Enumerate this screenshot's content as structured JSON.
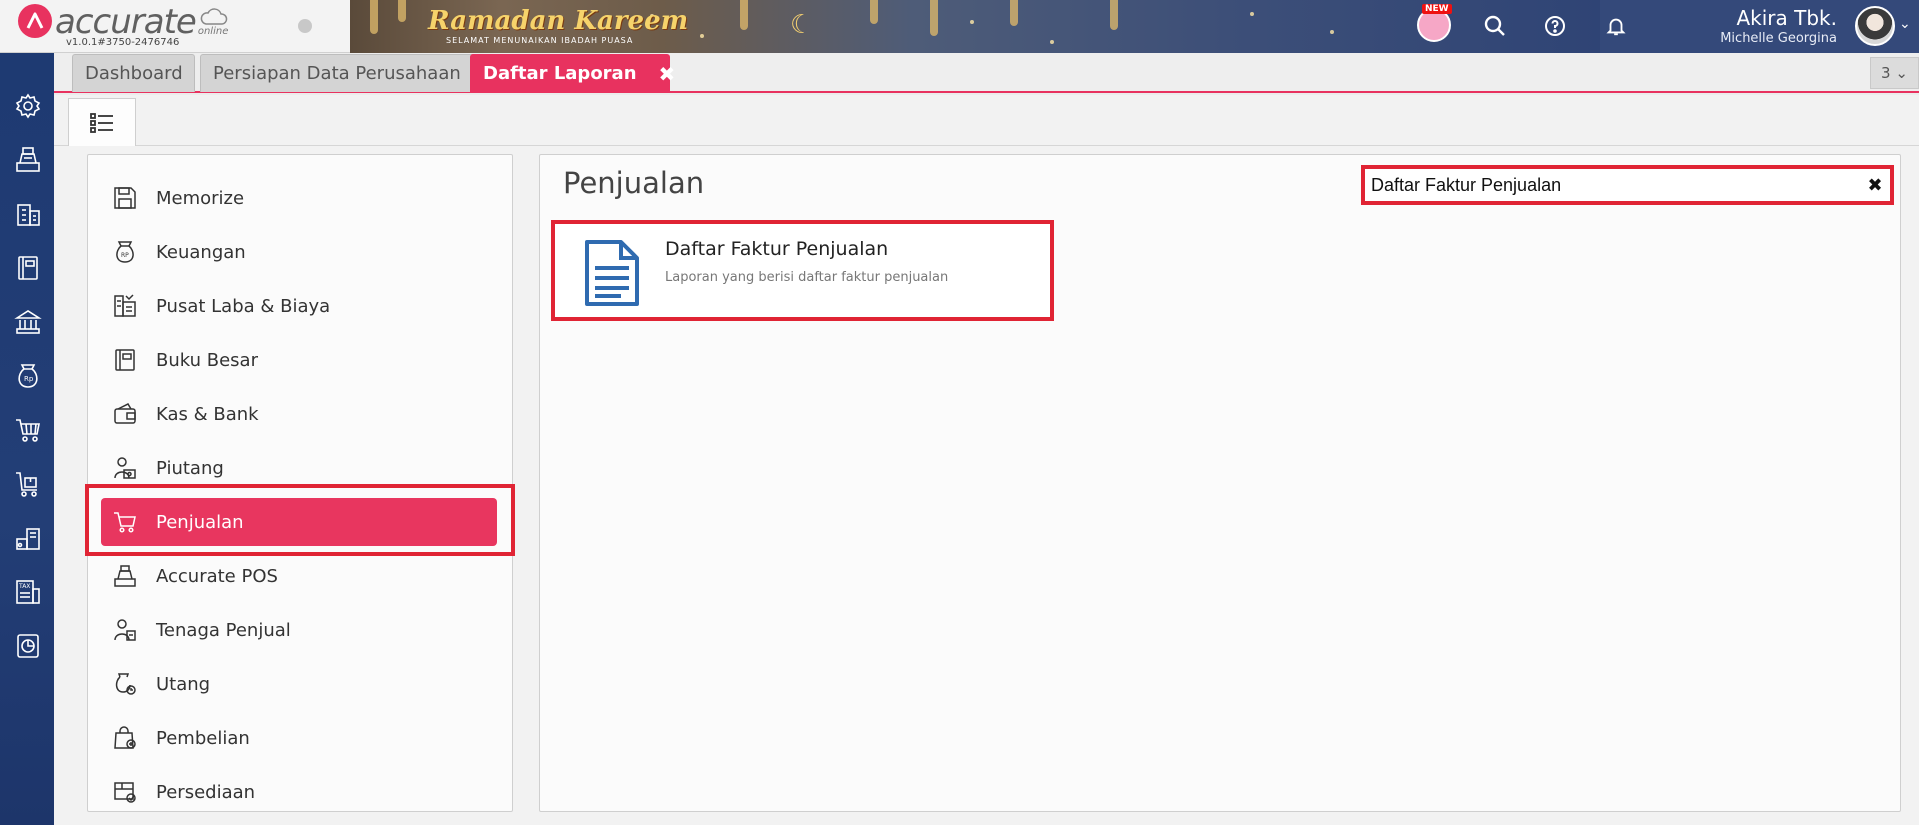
{
  "app": {
    "logo_text": "accurate",
    "logo_online": "online",
    "version": "v1.0.1#3750-2476746",
    "banner_title": "Ramadan Kareem",
    "banner_subtitle": "SELAMAT MENUNAIKAN IBADAH PUASA",
    "new_badge": "NEW",
    "user_name": "Akira Tbk.",
    "user_sub": "Michelle Georgina",
    "brand_color": "#e8325f",
    "nav_color": "#1e3a72"
  },
  "leftnav": [
    {
      "name": "gear-icon"
    },
    {
      "name": "cash-register-icon"
    },
    {
      "name": "building-icon"
    },
    {
      "name": "ledger-book-icon"
    },
    {
      "name": "bank-icon"
    },
    {
      "name": "money-bag-icon"
    },
    {
      "name": "shopping-cart-icon"
    },
    {
      "name": "cart-box-icon"
    },
    {
      "name": "warehouse-icon"
    },
    {
      "name": "tax-icon"
    },
    {
      "name": "report-chart-icon"
    }
  ],
  "tabs": [
    {
      "label": "Dashboard"
    },
    {
      "label": "Persiapan Data Perusahaan"
    },
    {
      "label": "Daftar Laporan",
      "closable": true
    }
  ],
  "tab_count": "3",
  "categories": [
    {
      "label": "Memorize",
      "icon": "floppy-disk-icon"
    },
    {
      "label": "Keuangan",
      "icon": "money-bag-icon"
    },
    {
      "label": "Pusat Laba & Biaya",
      "icon": "chart-building-icon"
    },
    {
      "label": "Buku Besar",
      "icon": "ledger-book-icon"
    },
    {
      "label": "Kas & Bank",
      "icon": "wallet-icon"
    },
    {
      "label": "Piutang",
      "icon": "person-money-icon"
    },
    {
      "label": "Penjualan",
      "icon": "shopping-cart-icon",
      "selected": true
    },
    {
      "label": "Accurate POS",
      "icon": "cash-register-icon"
    },
    {
      "label": "Tenaga Penjual",
      "icon": "salesperson-icon"
    },
    {
      "label": "Utang",
      "icon": "money-bag-clock-icon"
    },
    {
      "label": "Pembelian",
      "icon": "shopping-bag-icon"
    },
    {
      "label": "Persediaan",
      "icon": "inventory-box-icon"
    }
  ],
  "content": {
    "title": "Penjualan",
    "search_value": "Daftar Faktur Penjualan",
    "reports": [
      {
        "title": "Daftar Faktur Penjualan",
        "description": "Laporan yang berisi daftar faktur penjualan",
        "icon": "document-icon"
      }
    ]
  }
}
